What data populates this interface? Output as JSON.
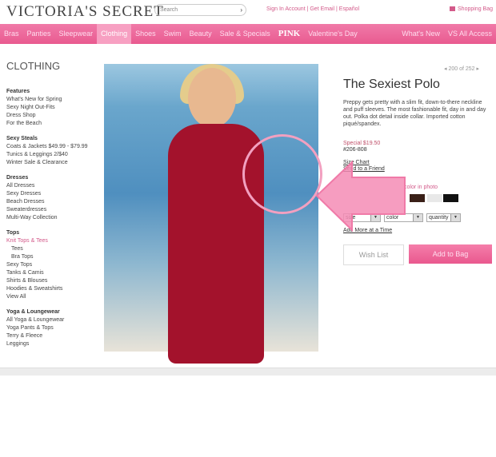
{
  "header": {
    "logo": "VICTORIA'S SECRET",
    "search_placeholder": "Search",
    "links": "Sign In  Account | Get Email | Español",
    "bag": "Shopping Bag"
  },
  "nav": [
    "Bras",
    "Panties",
    "Sleepwear",
    "Clothing",
    "Shoes",
    "Swim",
    "Beauty",
    "Sale & Specials",
    "PINK",
    "Valentine's Day",
    "What's New",
    "VS All Access"
  ],
  "sidebar": {
    "title": "CLOTHING",
    "groups": [
      {
        "heading": "Features",
        "items": [
          "What's New for Spring",
          "Sexy Night Out-Fits",
          "Dress Shop",
          "For the Beach"
        ]
      },
      {
        "heading": "Sexy Steals",
        "items": [
          "Coats & Jackets $49.99 - $79.99",
          "Tunics & Leggings 2/$40",
          "Winter Sale & Clearance"
        ]
      },
      {
        "heading": "Dresses",
        "items": [
          "All Dresses",
          "Sexy Dresses",
          "Beach Dresses",
          "Sweaterdresses",
          "Multi-Way Collection"
        ]
      },
      {
        "heading": "Tops",
        "items": [
          "Knit Tops & Tees",
          "Tees",
          "Bra Tops",
          "Sexy Tops",
          "Tanks & Camis",
          "Shirts & Blouses",
          "Hoodies & Sweatshirts",
          "View All"
        ]
      },
      {
        "heading": "Yoga & Loungewear",
        "items": [
          "All Yoga & Loungewear",
          "Yoga Pants & Tops",
          "Terry & Fleece",
          "Leggings"
        ]
      }
    ]
  },
  "product": {
    "pager": "200 of 252",
    "title": "The Sexiest Polo",
    "description": "Preppy gets pretty with a slim fit, down-to-there neckline and puff sleeves. The most fashionable fit, day in and day out. Polka dot detail inside collar. Imported cotton piqué/spandex.",
    "price": "Special $19.50",
    "sku": "#206-808",
    "size_chart": "Size Chart",
    "send_friend": "Send to a Friend",
    "color_label": "color in photo",
    "swatches": [
      "#3a2018",
      "#e8e8e8",
      "#111111"
    ],
    "size": "size",
    "color": "color",
    "quantity": "quantity",
    "add_more": "Add More at a Time",
    "wish_list": "Wish List",
    "add_to_bag": "Add to Bag"
  },
  "colors": {
    "accent": "#e95a90",
    "annotation": "#f48cb5"
  }
}
